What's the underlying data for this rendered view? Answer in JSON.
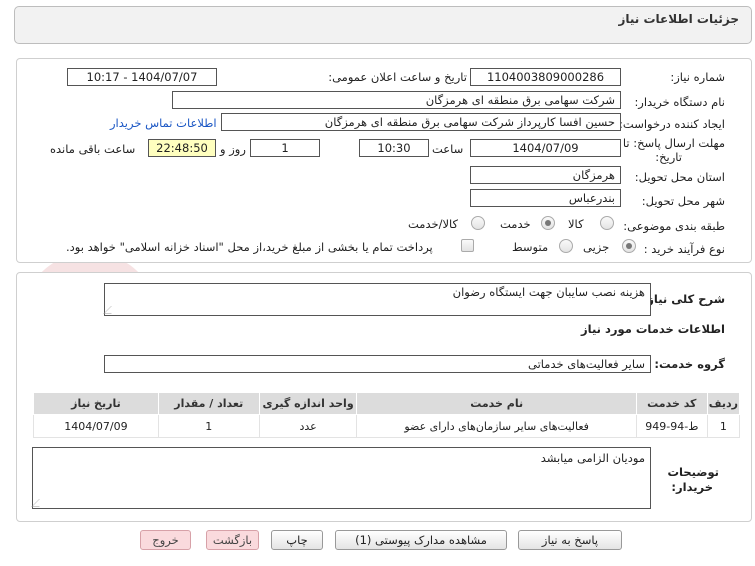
{
  "header": {
    "title": "جزئیات اطلاعات نیاز"
  },
  "form": {
    "need_number_label": "شماره نیاز:",
    "need_number": "1104003809000286",
    "announce_label": "تاریخ و ساعت اعلان عمومی:",
    "announce_value": "1404/07/07 - 10:17",
    "buyer_org_label": "نام دستگاه خریدار:",
    "buyer_org": "شرکت سهامی برق منطقه ای هرمزگان",
    "creator_label": "ایجاد کننده درخواست:",
    "creator": "حسین افسا کارپرداز شرکت سهامی برق منطقه ای هرمزگان",
    "contact_link": "اطلاعات تماس خریدار",
    "deadline_label_1": "مهلت ارسال پاسخ: تا",
    "deadline_label_2": "تاریخ:",
    "deadline_date": "1404/07/09",
    "time_label": "ساعت",
    "deadline_time": "10:30",
    "days_value": "1",
    "days_label": "روز و",
    "remaining_time": "22:48:50",
    "remaining_label": "ساعت باقی مانده",
    "province_label": "استان محل تحویل:",
    "province": "هرمزگان",
    "city_label": "شهر محل تحویل:",
    "city": "بندرعباس",
    "category_label": "طبقه بندی موضوعی:",
    "category_options": [
      "کالا",
      "خدمت",
      "کالا/خدمت"
    ],
    "process_label": "نوع فرآیند خرید :",
    "process_options": [
      "جزیی",
      "متوسط"
    ],
    "payment_note": "پرداخت تمام یا بخشی از مبلغ خرید،از محل \"اسناد خزانه اسلامی\" خواهد بود."
  },
  "description": {
    "label": "شرح کلی نیاز:",
    "value": "هزینه نصب سایبان جهت ایستگاه رضوان"
  },
  "services": {
    "section_title": "اطلاعات خدمات مورد نیاز",
    "group_label": "گروه خدمت:",
    "group_value": "سایر فعالیت‌های خدماتی",
    "columns": [
      "ردیف",
      "کد خدمت",
      "نام خدمت",
      "واحد اندازه گیری",
      "تعداد / مقدار",
      "تاریخ نیاز"
    ],
    "rows": [
      [
        "1",
        "ط-94-949",
        "فعالیت‌های سایر سازمان‌های دارای عضو",
        "عدد",
        "1",
        "1404/07/09"
      ]
    ]
  },
  "buyer_notes": {
    "label_1": "توضیحات",
    "label_2": "خریدار:",
    "value": "مودیان الزامی میابشد"
  },
  "buttons": {
    "reply": "پاسخ به نیاز",
    "attachments": "مشاهده مدارک پیوستی (1)",
    "print": "چاپ",
    "back": "بازگشت",
    "exit": "خروج"
  },
  "watermark": "AriaTender.net",
  "colors": {
    "link": "#1a56c4",
    "highlight": "#ffffbf",
    "exit_button": "#fadadd",
    "header_bg": "#f2f2f2"
  }
}
